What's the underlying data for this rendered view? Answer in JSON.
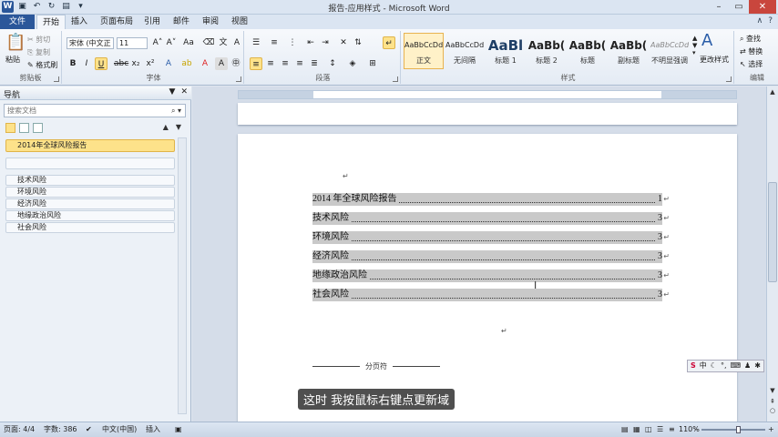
{
  "window": {
    "title": "报告-应用样式 - Microsoft Word"
  },
  "tabs": {
    "file": "文件",
    "items": [
      "开始",
      "插入",
      "页面布局",
      "引用",
      "邮件",
      "审阅",
      "视图"
    ],
    "active": "开始"
  },
  "ribbon": {
    "clipboard": {
      "label": "剪贴板",
      "paste": "粘贴",
      "cut": "剪切",
      "copy": "复制",
      "format_painter": "格式刷"
    },
    "font": {
      "label": "字体",
      "font_name": "宋体 (中文正",
      "font_size": "11",
      "bold": "B",
      "italic": "I",
      "underline": "U",
      "strike": "abc",
      "sub": "x₂",
      "sup": "x²"
    },
    "paragraph": {
      "label": "段落"
    },
    "styles": {
      "label": "样式",
      "items": [
        {
          "sample": "AaBbCcDd",
          "name": "正文"
        },
        {
          "sample": "AaBbCcDd",
          "name": "无间隔"
        },
        {
          "sample": "AaBl",
          "name": "标题 1"
        },
        {
          "sample": "AaBb(",
          "name": "标题 2"
        },
        {
          "sample": "AaBb(",
          "name": "标题"
        },
        {
          "sample": "AaBb(",
          "name": "副标题"
        },
        {
          "sample": "AaBbCcDd",
          "name": "不明显强调"
        }
      ],
      "change_styles": "更改样式"
    },
    "editing": {
      "label": "编辑",
      "find": "查找",
      "replace": "替换",
      "select": "选择"
    }
  },
  "nav": {
    "title": "导航",
    "search_placeholder": "搜索文档",
    "headings": [
      "2014年全球风险报告",
      "技术风险",
      "环境风险",
      "经济风险",
      "地缘政治风险",
      "社会风险"
    ]
  },
  "document": {
    "toc": [
      {
        "title": "2014 年全球风险报告",
        "page": "1"
      },
      {
        "title": "技术风险",
        "page": "3"
      },
      {
        "title": "环境风险",
        "page": "3"
      },
      {
        "title": "经济风险",
        "page": "3"
      },
      {
        "title": "地缘政治风险",
        "page": "3"
      },
      {
        "title": "社会风险",
        "page": "3"
      }
    ],
    "page_break_label": "分页符",
    "ime": "中",
    "subtitle": "这时 我按鼠标右键点更新域"
  },
  "status": {
    "page": "页面: 4/4",
    "words": "字数: 386",
    "language": "中文(中国)",
    "mode": "插入",
    "zoom": "110%"
  }
}
